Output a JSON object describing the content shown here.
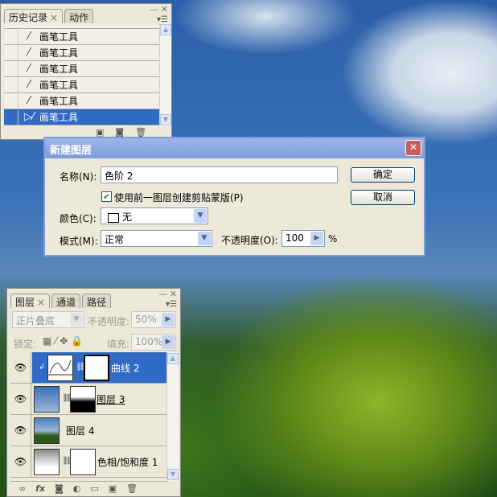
{
  "history_panel": {
    "tabs": [
      {
        "label": "历史记录",
        "active": true
      },
      {
        "label": "动作",
        "active": false
      }
    ],
    "items": [
      "画笔工具",
      "画笔工具",
      "画笔工具",
      "画笔工具",
      "画笔工具",
      "画笔工具"
    ],
    "selected_index": 5
  },
  "dialog": {
    "title": "新建图层",
    "name_label": "名称(N):",
    "name_value": "色阶 2",
    "clip_label": "使用前一图层创建剪贴蒙版(P)",
    "clip_checked": true,
    "color_label": "颜色(C):",
    "color_value": "无",
    "mode_label": "模式(M):",
    "mode_value": "正常",
    "opacity_label": "不透明度(O):",
    "opacity_value": "100",
    "opacity_unit": "%",
    "ok": "确定",
    "cancel": "取消"
  },
  "layers_panel": {
    "tabs": [
      {
        "label": "图层",
        "active": true
      },
      {
        "label": "通道",
        "active": false
      },
      {
        "label": "路径",
        "active": false
      }
    ],
    "blend_mode": "正片叠底",
    "opacity_label": "不透明度:",
    "opacity_value": "50%",
    "lock_label": "锁定:",
    "fill_label": "填充:",
    "fill_value": "100%",
    "layers": [
      {
        "name": "曲线 2",
        "selected": true
      },
      {
        "name": "图层 3",
        "selected": false
      },
      {
        "name": "图层 4",
        "selected": false
      },
      {
        "name": "色相/饱和度 1",
        "selected": false
      }
    ]
  }
}
